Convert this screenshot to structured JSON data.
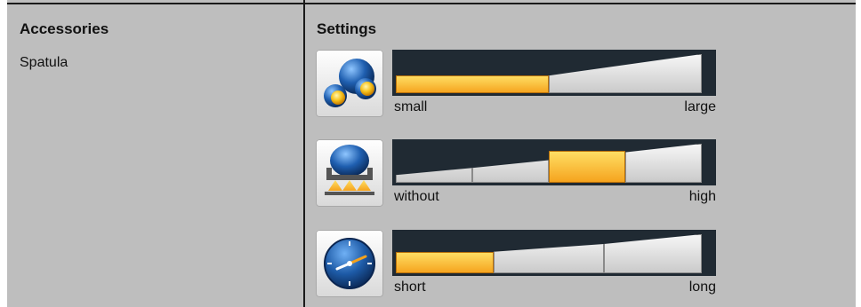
{
  "accessories": {
    "heading": "Accessories",
    "items": [
      "Spatula"
    ]
  },
  "settings": {
    "heading": "Settings",
    "rows": [
      {
        "icon": "size-spheres-icon",
        "min_label": "small",
        "max_label": "large",
        "segments": 2,
        "active_segment": 1
      },
      {
        "icon": "pressure-dome-icon",
        "min_label": "without",
        "max_label": "high",
        "segments": 4,
        "active_segment": 3
      },
      {
        "icon": "clock-icon",
        "min_label": "short",
        "max_label": "long",
        "segments": 3,
        "active_segment": 1
      }
    ]
  },
  "colors": {
    "background": "#bebebe",
    "accent": "#f5a21c",
    "bar_frame": "#202a33"
  }
}
